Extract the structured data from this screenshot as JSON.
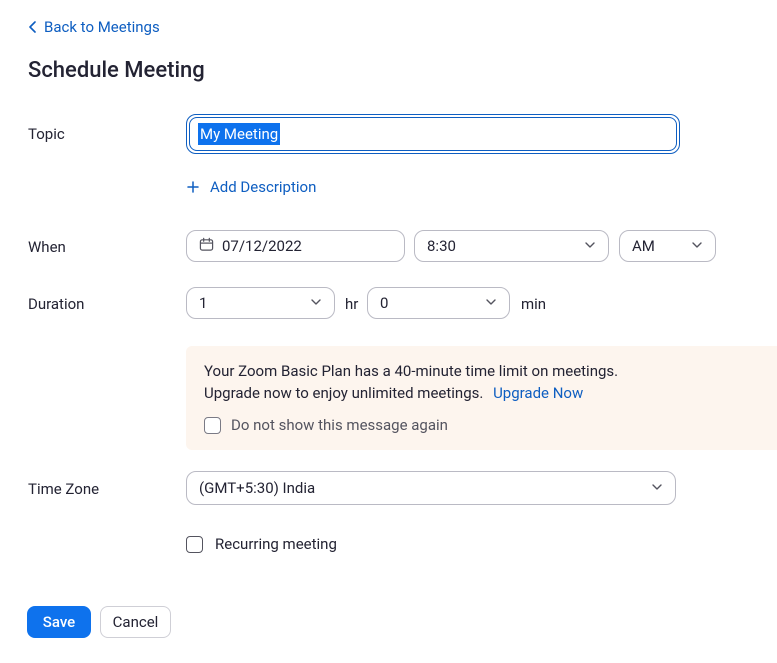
{
  "back": {
    "label": "Back to Meetings"
  },
  "title": "Schedule Meeting",
  "labels": {
    "topic": "Topic",
    "when": "When",
    "duration": "Duration",
    "timezone": "Time Zone"
  },
  "topic": {
    "value": "My Meeting"
  },
  "add_description": "Add Description",
  "when": {
    "date": "07/12/2022",
    "time": "8:30",
    "ampm": "AM"
  },
  "duration": {
    "hours": "1",
    "hr_label": "hr",
    "minutes": "0",
    "min_label": "min"
  },
  "notice": {
    "line1": "Your Zoom Basic Plan has a 40-minute time limit on meetings.",
    "line2": "Upgrade now to enjoy unlimited meetings.",
    "upgrade_label": "Upgrade Now",
    "dont_show": "Do not show this message again"
  },
  "timezone": {
    "value": "(GMT+5:30) India"
  },
  "recurring": {
    "label": "Recurring meeting"
  },
  "buttons": {
    "save": "Save",
    "cancel": "Cancel"
  }
}
